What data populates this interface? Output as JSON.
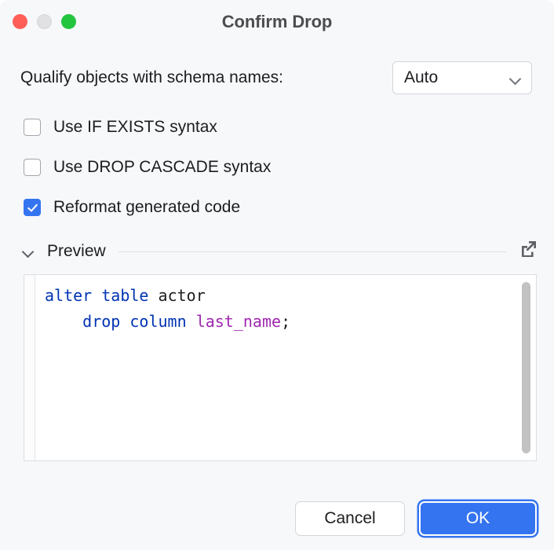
{
  "window": {
    "title": "Confirm Drop",
    "traffic_lights": [
      {
        "name": "close",
        "color": "#ff5f57"
      },
      {
        "name": "minimize",
        "color": "#e1e1e3"
      },
      {
        "name": "zoom",
        "color": "#23c53f"
      }
    ]
  },
  "schema": {
    "label": "Qualify objects with schema names:",
    "selected": "Auto",
    "options": [
      "Auto"
    ],
    "chevron_icon": "chevron-down-icon"
  },
  "checkboxes": [
    {
      "label": "Use IF EXISTS syntax",
      "checked": false
    },
    {
      "label": "Use DROP CASCADE syntax",
      "checked": false
    },
    {
      "label": "Reformat generated code",
      "checked": true
    }
  ],
  "preview": {
    "title": "Preview",
    "collapse_icon": "chevron-down-icon",
    "expand_icon": "external-link-icon",
    "code_lines": [
      [
        {
          "text": "alter",
          "type": "keyword"
        },
        {
          "text": " ",
          "type": "plain"
        },
        {
          "text": "table",
          "type": "keyword"
        },
        {
          "text": " ",
          "type": "plain"
        },
        {
          "text": "actor",
          "type": "identifier"
        }
      ],
      [
        {
          "text": "    ",
          "type": "plain"
        },
        {
          "text": "drop",
          "type": "keyword"
        },
        {
          "text": " ",
          "type": "plain"
        },
        {
          "text": "column",
          "type": "keyword"
        },
        {
          "text": " ",
          "type": "plain"
        },
        {
          "text": "last_name",
          "type": "column"
        },
        {
          "text": ";",
          "type": "punctuation"
        }
      ]
    ]
  },
  "footer": {
    "cancel_label": "Cancel",
    "ok_label": "OK"
  },
  "colors": {
    "accent": "#3574f0",
    "dialog_bg": "#f7f8fa",
    "editor_bg": "#ffffff",
    "keyword": "#0033b3",
    "column": "#9e27ae",
    "text": "#1c1d20",
    "title_text": "#4d4d4f",
    "border": "#d3d5da"
  }
}
